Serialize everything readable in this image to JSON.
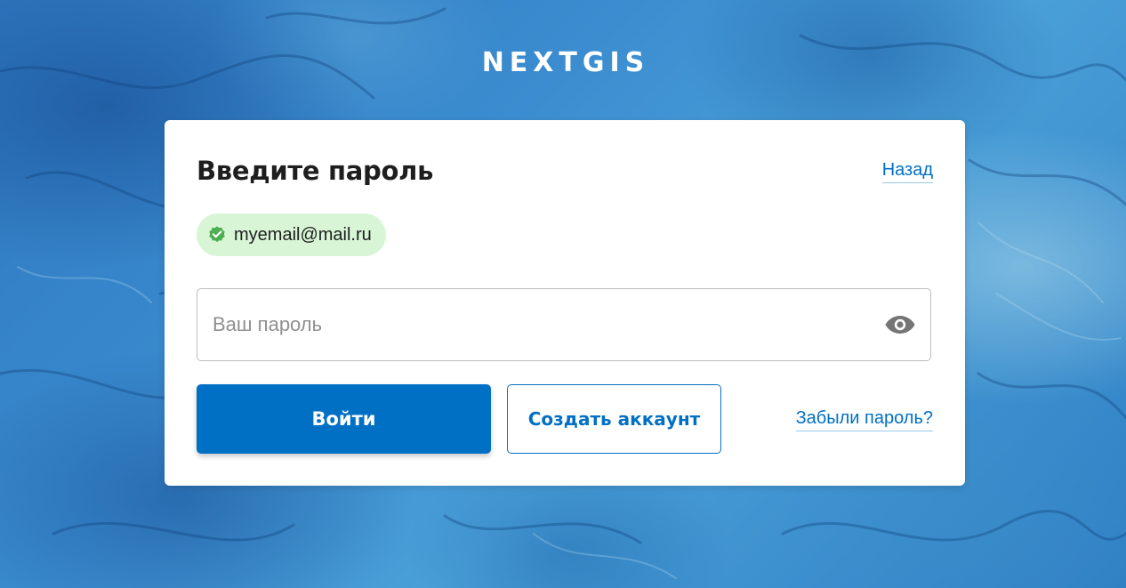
{
  "brand": {
    "logo_text": "NEXTGIS"
  },
  "login": {
    "title": "Введите пароль",
    "back_label": "Назад",
    "email": "myemail@mail.ru",
    "password_placeholder": "Ваш пароль",
    "password_value": "",
    "login_button": "Войти",
    "create_account_button": "Создать аккаунт",
    "forgot_link": "Забыли пароль?"
  },
  "colors": {
    "accent": "#0070c5",
    "chip_bg": "#d8f5d6",
    "chip_check": "#4caf50",
    "background": "#3a8bcf"
  },
  "icons": {
    "verified": "check-badge-icon",
    "show_password": "eye-icon"
  }
}
